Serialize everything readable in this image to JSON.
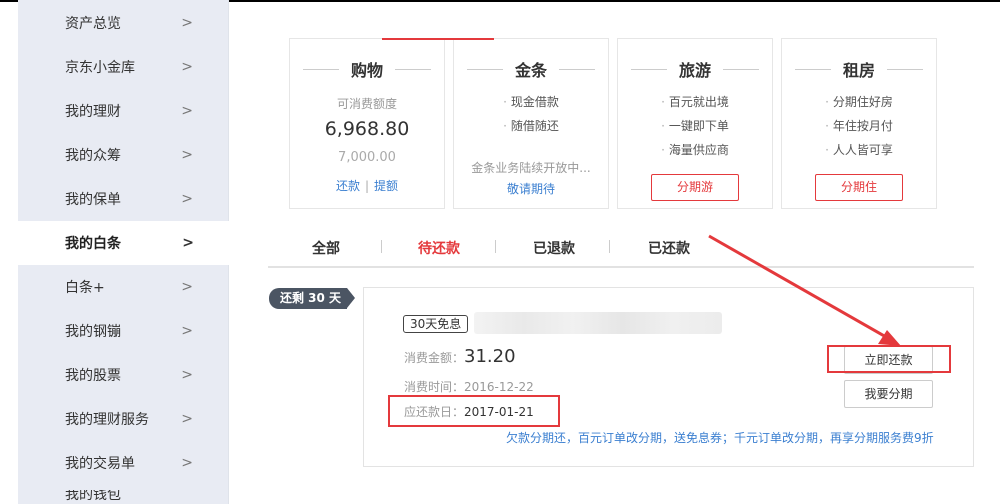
{
  "sidebar": {
    "items": [
      {
        "label": "资产总览"
      },
      {
        "label": "京东小金库"
      },
      {
        "label": "我的理财"
      },
      {
        "label": "我的众筹"
      },
      {
        "label": "我的保单"
      },
      {
        "label": "我的白条"
      },
      {
        "label": "白条+"
      },
      {
        "label": "我的钢镚"
      },
      {
        "label": "我的股票"
      },
      {
        "label": "我的理财服务"
      },
      {
        "label": "我的交易单"
      },
      {
        "label": "我的钱包"
      }
    ],
    "chevron": ">"
  },
  "cards": {
    "shopping": {
      "title": "购物",
      "available_label": "可消费额度",
      "available": "6,968.80",
      "limit": "7,000.00",
      "repay_link": "还款",
      "separator": "|",
      "raise_link": "提额"
    },
    "jintiao": {
      "title": "金条",
      "features": [
        "现金借款",
        "随借随还"
      ],
      "notice": "金条业务陆续开放中...",
      "stay_tuned": "敬请期待"
    },
    "travel": {
      "title": "旅游",
      "features": [
        "百元就出境",
        "一键即下单",
        "海量供应商"
      ],
      "button": "分期游"
    },
    "rent": {
      "title": "租房",
      "features": [
        "分期住好房",
        "年住按月付",
        "人人皆可享"
      ],
      "button": "分期住"
    }
  },
  "tabs": [
    {
      "label": "全部"
    },
    {
      "label": "待还款"
    },
    {
      "label": "已退款"
    },
    {
      "label": "已还款"
    }
  ],
  "bill": {
    "remaining_badge": "还剩 30 天",
    "tag": "30天免息",
    "amount_label": "消费金额：",
    "amount": "31.20",
    "time_label": "消费时间：",
    "time": "2016-12-22",
    "due_label": "应还款日：",
    "due": "2017-01-21",
    "repay_now_button": "立即还款",
    "installment_button": "我要分期",
    "promo": "欠款分期还，百元订单改分期，送免息券；千元订单改分期，再享分期服务费9折"
  },
  "colors": {
    "accent_red": "#e4393c",
    "link_blue": "#3b7fd0",
    "sidebar_bg": "#e8ebf3",
    "badge_bg": "#4b5563"
  }
}
